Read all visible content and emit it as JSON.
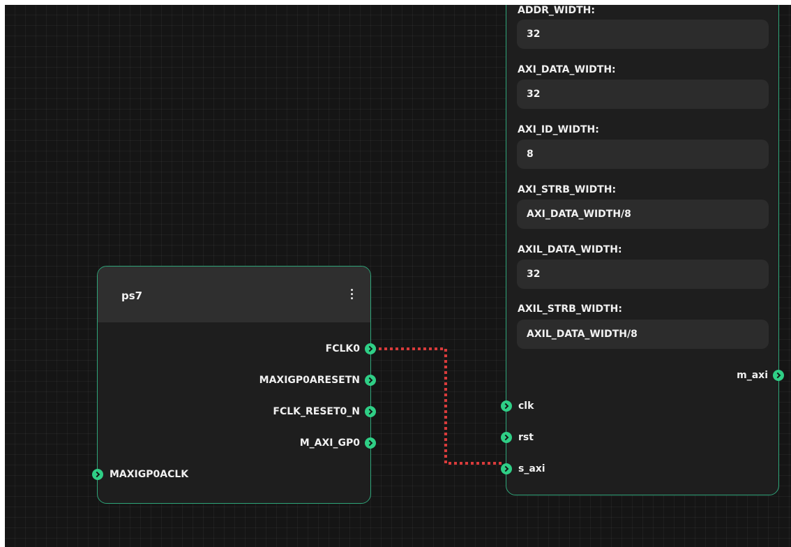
{
  "ps7": {
    "title": "ps7",
    "outputs": [
      "FCLK0",
      "MAXIGP0ARESETN",
      "FCLK_RESET0_N",
      "M_AXI_GP0"
    ],
    "inputs": [
      "MAXIGP0ACLK"
    ]
  },
  "block": {
    "params": [
      {
        "label": "ADDR_WIDTH:",
        "value": "32"
      },
      {
        "label": "AXI_DATA_WIDTH:",
        "value": "32"
      },
      {
        "label": "AXI_ID_WIDTH:",
        "value": "8"
      },
      {
        "label": "AXI_STRB_WIDTH:",
        "value": "AXI_DATA_WIDTH/8"
      },
      {
        "label": "AXIL_DATA_WIDTH:",
        "value": "32"
      },
      {
        "label": "AXIL_STRB_WIDTH:",
        "value": "AXIL_DATA_WIDTH/8"
      }
    ],
    "outputs": [
      "m_axi"
    ],
    "inputs": [
      "clk",
      "rst",
      "s_axi"
    ]
  },
  "connection": {
    "from": "FCLK0",
    "to": "s_axi",
    "color": "#d93b3b",
    "style": "dotted"
  },
  "colors": {
    "canvas": "#151515",
    "node_body": "#1e1e1e",
    "node_header": "#2f2f2f",
    "node_border": "#2fa67a",
    "port": "#2fcf86",
    "field_bg": "#2c2c2c"
  }
}
